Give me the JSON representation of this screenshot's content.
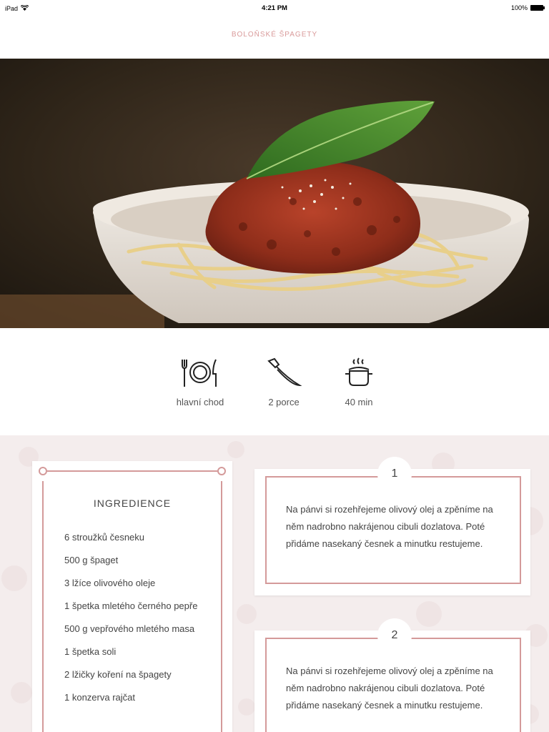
{
  "status_bar": {
    "device": "iPad",
    "time": "4:21 PM",
    "battery": "100%"
  },
  "nav": {
    "title": "BOLOŇSKÉ ŠPAGETY"
  },
  "hero": {
    "image": "spaghetti-bolognese-photo"
  },
  "meta": [
    {
      "icon": "plate-cutlery-icon",
      "label": "hlavní chod"
    },
    {
      "icon": "knife-icon",
      "label": "2 porce"
    },
    {
      "icon": "pot-icon",
      "label": "40 min"
    }
  ],
  "ingredients": {
    "title": "INGREDIENCE",
    "items": [
      "6 stroužků česneku",
      "500 g špaget",
      "3 lžíce olivového oleje",
      "1 špetka mletého černého pepře",
      "500 g vepřového mletého masa",
      "1 špetka soli",
      "2 lžičky koření na špagety",
      "1 konzerva rajčat"
    ]
  },
  "steps": [
    {
      "number": "1",
      "text": "Na pánvi si rozehřejeme olivový olej a zpěníme na něm nadrobno nakrájenou cibuli dozlatova. Poté přidáme nasekaný česnek a minutku restujeme."
    },
    {
      "number": "2",
      "text": "Na pánvi si rozehřejeme olivový olej a zpěníme na něm nadrobno nakrájenou cibuli dozlatova. Poté přidáme nasekaný česnek a minutku restujeme."
    }
  ],
  "colors": {
    "accent": "#d49a9a",
    "background": "#f4eded",
    "text": "#444444"
  }
}
